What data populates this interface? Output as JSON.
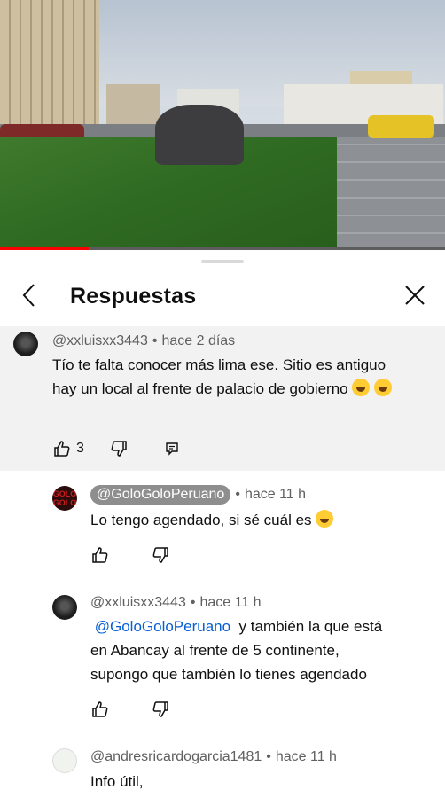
{
  "video": {
    "progress_fraction": 0.2
  },
  "sheet": {
    "title": "Respuestas"
  },
  "comments": [
    {
      "author": "@xxluisxx3443",
      "time": "hace 2 días",
      "text": "Tío te falta conocer más lima ese. Sitio es antiguo hay un local al frente de palacio de gobierno",
      "emoji": [
        "face-with-tears-of-joy",
        "face-with-tears-of-joy"
      ],
      "like_count": "3"
    },
    {
      "author": "@GoloGoloPeruano",
      "author_is_creator": true,
      "time": "hace 11 h",
      "text": "Lo tengo agendado, si sé cuál es",
      "emoji": [
        "grinning-face"
      ]
    },
    {
      "author": "@xxluisxx3443",
      "time": "hace 11 h",
      "mention": "@GoloGoloPeruano",
      "text_line1": "y también la que está",
      "text_line2": "en Abancay al frente de 5 continente,",
      "text_line3": "supongo que también lo tienes agendado"
    },
    {
      "author": "@andresricardogarcia1481",
      "time": "hace 11 h",
      "text": "Info útil,"
    }
  ],
  "avatar_labels": {
    "golo_line1": "GOLO",
    "golo_line2": "GOLO"
  },
  "colors": {
    "mention": "#065fd4",
    "progress": "#ff0000",
    "parent_bg": "#f2f2f2"
  },
  "icons": {
    "back": "chevron-left-icon",
    "close": "close-icon",
    "like": "thumbs-up-icon",
    "dislike": "thumbs-down-icon",
    "reply": "reply-comment-icon"
  }
}
